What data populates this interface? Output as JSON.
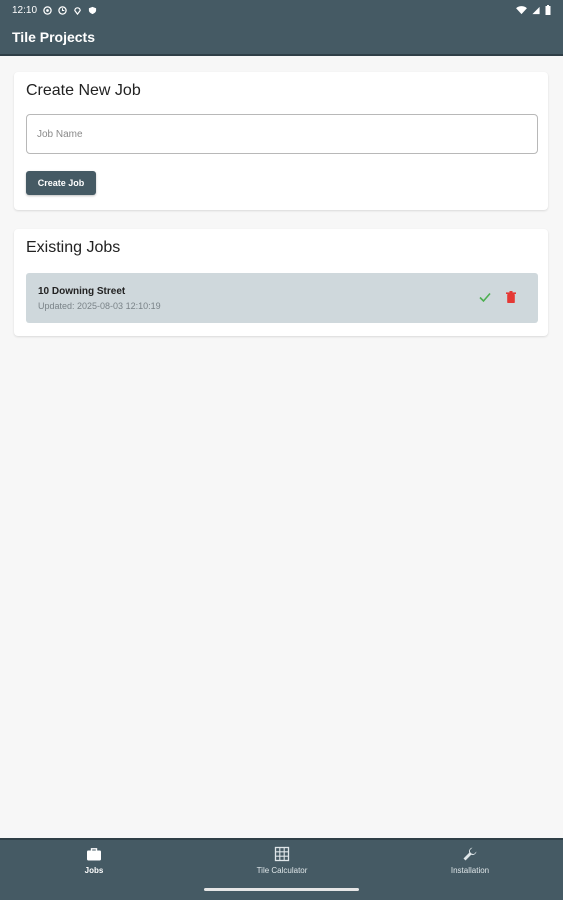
{
  "status_bar": {
    "time": "12:10",
    "icons": [
      "settings-icon",
      "clock-icon",
      "location-icon",
      "shield-icon"
    ],
    "right_icons": [
      "wifi-icon",
      "signal-icon",
      "battery-icon"
    ]
  },
  "app_bar": {
    "title": "Tile Projects"
  },
  "create_card": {
    "title": "Create New Job",
    "input_placeholder": "Job Name",
    "input_value": "",
    "button_label": "Create Job"
  },
  "existing_card": {
    "title": "Existing Jobs",
    "jobs": [
      {
        "name": "10 Downing Street",
        "updated": "Updated: 2025-08-03 12:10:19"
      }
    ]
  },
  "bottom_nav": {
    "items": [
      {
        "label": "Jobs",
        "icon": "briefcase-icon",
        "active": true
      },
      {
        "label": "Tile Calculator",
        "icon": "grid-icon",
        "active": false
      },
      {
        "label": "Installation",
        "icon": "wrench-icon",
        "active": false
      }
    ]
  },
  "colors": {
    "primary": "#455a64",
    "job_row_bg": "#cfd8dc",
    "check": "#4caf50",
    "delete": "#e53935",
    "background": "#f7f7f7"
  }
}
